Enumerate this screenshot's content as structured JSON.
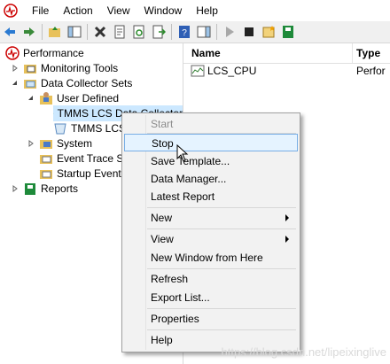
{
  "menubar": {
    "items": [
      "File",
      "Action",
      "View",
      "Window",
      "Help"
    ]
  },
  "tree": {
    "root": "Performance",
    "monitoring_tools": "Monitoring Tools",
    "data_collector_sets": "Data Collector Sets",
    "user_defined": "User Defined",
    "dcs1": "TMMS LCS Data Collector",
    "dcs2": "TMMS LCS",
    "system": "System",
    "event_trace": "Event Trace Ses",
    "startup_event": "Startup Event T",
    "reports": "Reports"
  },
  "list": {
    "columns": [
      "Name",
      "Type"
    ],
    "rows": [
      {
        "name": "LCS_CPU",
        "type": "Perfor"
      }
    ]
  },
  "context_menu": {
    "items": {
      "start": "Start",
      "stop": "Stop",
      "save_template": "Save Template...",
      "data_manager": "Data Manager...",
      "latest_report": "Latest Report",
      "new": "New",
      "view": "View",
      "new_window": "New Window from Here",
      "refresh": "Refresh",
      "export_list": "Export List...",
      "properties": "Properties",
      "help": "Help"
    }
  },
  "watermark": "https://blog.csdn.net/lipeixinglive"
}
